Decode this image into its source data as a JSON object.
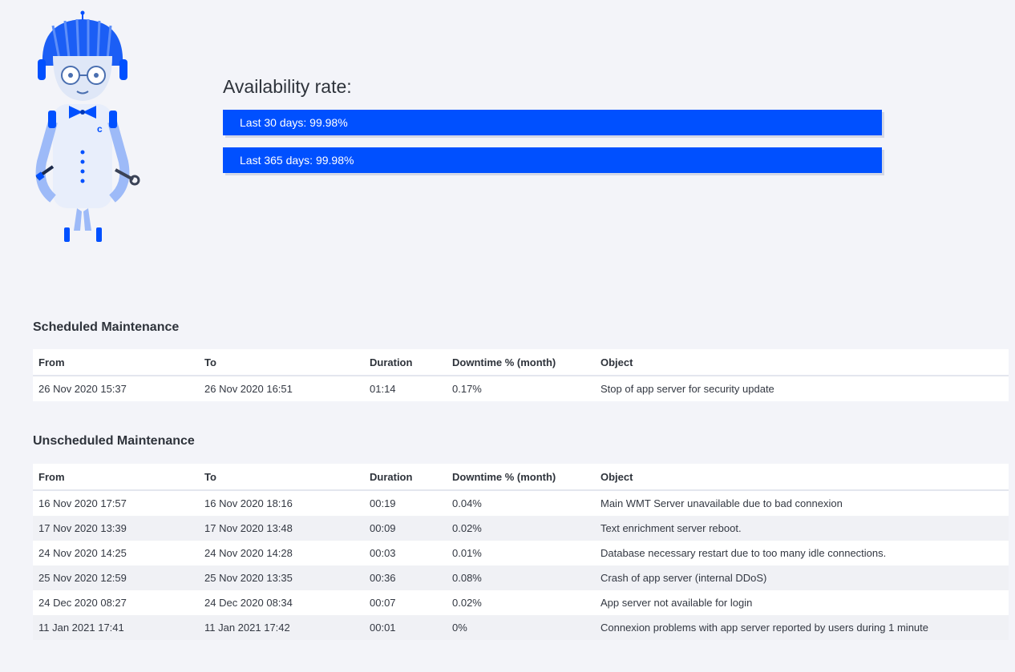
{
  "availability": {
    "title": "Availability rate:",
    "bars": [
      "Last 30 days: 99.98%",
      "Last 365 days: 99.98%"
    ],
    "accent_color": "#0050ff"
  },
  "mascot": {
    "icon": "robot-mascot-icon"
  },
  "columns": [
    "From",
    "To",
    "Duration",
    "Downtime % (month)",
    "Object"
  ],
  "scheduled": {
    "title": "Scheduled Maintenance",
    "rows": [
      [
        "26 Nov 2020 15:37",
        "26 Nov 2020 16:51",
        "01:14",
        "0.17%",
        "Stop of app server for security update"
      ]
    ]
  },
  "unscheduled": {
    "title": "Unscheduled Maintenance",
    "rows": [
      [
        "16 Nov 2020 17:57",
        "16 Nov 2020 18:16",
        "00:19",
        "0.04%",
        "Main WMT Server unavailable due to bad connexion"
      ],
      [
        "17 Nov 2020 13:39",
        "17 Nov 2020 13:48",
        "00:09",
        "0.02%",
        "Text enrichment server reboot."
      ],
      [
        "24 Nov 2020 14:25",
        "24 Nov 2020 14:28",
        "00:03",
        "0.01%",
        "Database necessary restart due to too many idle connections."
      ],
      [
        "25 Nov 2020 12:59",
        "25 Nov 2020 13:35",
        "00:36",
        "0.08%",
        "Crash of app server (internal DDoS)"
      ],
      [
        "24 Dec 2020 08:27",
        "24 Dec 2020 08:34",
        "00:07",
        "0.02%",
        "App server not available for login"
      ],
      [
        "11 Jan 2021 17:41",
        "11 Jan 2021 17:42",
        "00:01",
        "0%",
        "Connexion problems with app server reported by users during 1 minute"
      ]
    ]
  }
}
